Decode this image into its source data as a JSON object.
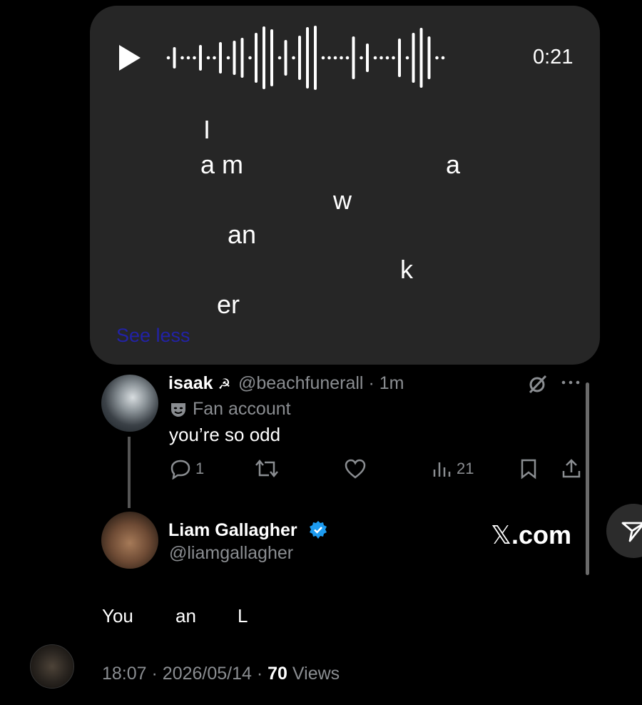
{
  "voice_message": {
    "duration": "0:21",
    "play_icon": "play-icon",
    "transcript_words": [
      "I",
      "a m",
      "a",
      "w",
      "an",
      "k",
      "er"
    ],
    "see_less_label": "See less"
  },
  "reply_tweet": {
    "display_name": "isaak",
    "name_emoji": "☭",
    "handle": "@beachfunerall",
    "separator": "·",
    "time_ago": "1m",
    "label_icon": "theater-mask-icon",
    "label": "Fan account",
    "text": "you’re so odd",
    "reply_count": "1",
    "views_count": "21",
    "header_icons": [
      "grok-icon",
      "more-icon"
    ],
    "action_icons": [
      "reply-icon",
      "retweet-icon",
      "like-icon",
      "views-icon",
      "bookmark-icon",
      "share-icon"
    ]
  },
  "quoted_card": {
    "display_name": "Liam Gallagher",
    "handle": "@liamgallagher",
    "verified_icon": "verified-badge-icon",
    "source": "𝕏.com",
    "source_x": "𝕏",
    "source_rest": ".com"
  },
  "main_text_words": [
    "You",
    "an",
    "L"
  ],
  "footer": {
    "time": "18:07",
    "sep1": "·",
    "date": "2026/05/14",
    "sep2": "·",
    "views": "70",
    "views_label": "Views"
  },
  "share_fab_icon": "send-icon",
  "colors": {
    "background": "#000000",
    "card": "#262626",
    "muted_text": "#8a8d91",
    "see_less_link": "#2222a6",
    "verified": "#1d9bf0"
  }
}
